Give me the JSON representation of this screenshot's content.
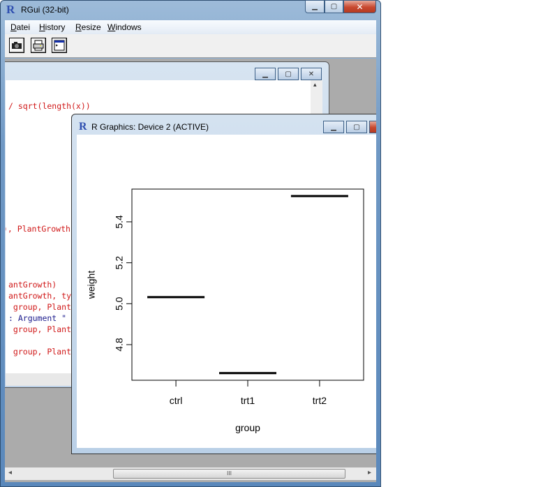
{
  "rgui": {
    "title": "RGui (32-bit)",
    "menu": [
      {
        "label": "Datei",
        "accel": "D"
      },
      {
        "label": "History",
        "accel": "H"
      },
      {
        "label": "Resize",
        "accel": "R"
      },
      {
        "label": "Windows",
        "accel": "W"
      }
    ],
    "toolbar": [
      {
        "name": "copy-as-bitmap",
        "icon": "camera-icon",
        "glyph": "📷"
      },
      {
        "name": "print",
        "icon": "printer-icon",
        "glyph": "🖶"
      },
      {
        "name": "console",
        "icon": "console-window-icon",
        "glyph": "▭"
      }
    ],
    "caption_buttons": {
      "minimize": "▁",
      "maximize": "▢",
      "close": "✕"
    },
    "hscroll_grip": "III",
    "scroll_left": "◂",
    "scroll_right": "▸"
  },
  "console": {
    "lines": [
      {
        "text": "/ sqrt(length(x))",
        "color": "red"
      },
      {
        "text": "), PlantGrowth",
        "color": "red"
      },
      {
        "text": "antGrowth)",
        "color": "red"
      },
      {
        "text": "antGrowth, ty",
        "color": "red"
      },
      {
        "text": " group, Plant",
        "color": "red"
      },
      {
        "text": ": Argument \"",
        "color": "blue"
      },
      {
        "text": " group, Plant",
        "color": "red"
      },
      {
        "text": " group, Plant",
        "color": "red"
      }
    ],
    "scroll_up": "▴",
    "caption_buttons": {
      "minimize": "▁",
      "maximize": "▢",
      "close": "✕"
    }
  },
  "graphics": {
    "title": "R Graphics: Device 2 (ACTIVE)",
    "caption_buttons": {
      "minimize": "▁",
      "maximize": "▢"
    }
  },
  "chart_data": {
    "type": "bar",
    "style": "horizontal-segments (bargraph means as line markers)",
    "categories": [
      "ctrl",
      "trt1",
      "trt2"
    ],
    "values": [
      5.032,
      4.661,
      5.526
    ],
    "title": "",
    "xlabel": "group",
    "ylabel": "weight",
    "ylim": [
      4.626,
      5.56
    ],
    "yticks": [
      4.8,
      5.0,
      5.2,
      5.4
    ],
    "ytick_labels": [
      "4.8",
      "5.0",
      "5.2",
      "5.4"
    ],
    "grid": false,
    "legend": "none"
  }
}
